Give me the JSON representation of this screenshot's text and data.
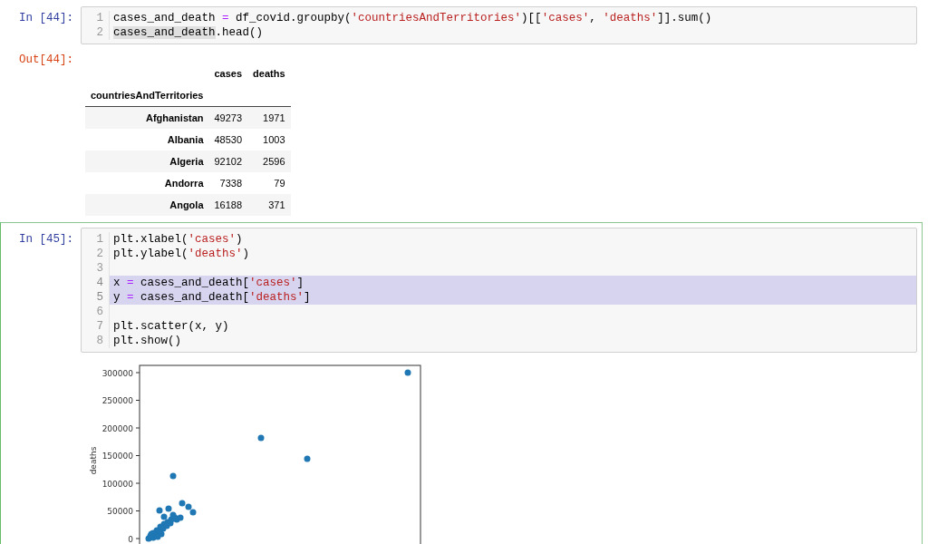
{
  "cells": [
    {
      "prompt": "In [44]:",
      "selected": false,
      "code": [
        {
          "number": "1",
          "highlighted": false,
          "tokens": [
            {
              "text": "cases_and_death ",
              "kind": "plain"
            },
            {
              "text": "=",
              "kind": "operator"
            },
            {
              "text": " df_covid.groupby(",
              "kind": "plain"
            },
            {
              "text": "'countriesAndTerritories'",
              "kind": "string"
            },
            {
              "text": ")[[",
              "kind": "plain"
            },
            {
              "text": "'cases'",
              "kind": "string"
            },
            {
              "text": ", ",
              "kind": "plain"
            },
            {
              "text": "'deaths'",
              "kind": "string"
            },
            {
              "text": "]].sum()",
              "kind": "plain"
            }
          ]
        },
        {
          "number": "2",
          "highlighted": false,
          "tokens": [
            {
              "text": "cases_and_death",
              "kind": "match"
            },
            {
              "text": ".head()",
              "kind": "plain"
            }
          ]
        }
      ],
      "output": {
        "prompt": "Out[44]:",
        "table": {
          "columns": [
            "cases",
            "deaths"
          ],
          "index_name": "countriesAndTerritories",
          "rows": [
            {
              "index": "Afghanistan",
              "values": [
                "49273",
                "1971"
              ]
            },
            {
              "index": "Albania",
              "values": [
                "48530",
                "1003"
              ]
            },
            {
              "index": "Algeria",
              "values": [
                "92102",
                "2596"
              ]
            },
            {
              "index": "Andorra",
              "values": [
                "7338",
                "79"
              ]
            },
            {
              "index": "Angola",
              "values": [
                "16188",
                "371"
              ]
            }
          ]
        }
      }
    },
    {
      "prompt": "In [45]:",
      "selected": true,
      "code": [
        {
          "number": "1",
          "highlighted": false,
          "tokens": [
            {
              "text": "plt.xlabel(",
              "kind": "plain"
            },
            {
              "text": "'cases'",
              "kind": "string"
            },
            {
              "text": ")",
              "kind": "plain"
            }
          ]
        },
        {
          "number": "2",
          "highlighted": false,
          "tokens": [
            {
              "text": "plt.ylabel(",
              "kind": "plain"
            },
            {
              "text": "'deaths'",
              "kind": "string"
            },
            {
              "text": ")",
              "kind": "plain"
            }
          ]
        },
        {
          "number": "3",
          "highlighted": false
        },
        {
          "number": "4",
          "highlighted": true,
          "tokens": [
            {
              "text": "x ",
              "kind": "plain"
            },
            {
              "text": "=",
              "kind": "operator"
            },
            {
              "text": " cases_and_death[",
              "kind": "plain"
            },
            {
              "text": "'cases'",
              "kind": "string"
            },
            {
              "text": "]",
              "kind": "plain"
            }
          ]
        },
        {
          "number": "5",
          "highlighted": true,
          "tokens": [
            {
              "text": "y ",
              "kind": "plain"
            },
            {
              "text": "=",
              "kind": "operator"
            },
            {
              "text": " cases_and_death[",
              "kind": "plain"
            },
            {
              "text": "'deaths'",
              "kind": "string"
            },
            {
              "text": "]",
              "kind": "plain"
            }
          ]
        },
        {
          "number": "6",
          "highlighted": false
        },
        {
          "number": "7",
          "highlighted": false,
          "tokens": [
            {
              "text": "plt.scatter(x, y)",
              "kind": "plain"
            }
          ]
        },
        {
          "number": "8",
          "highlighted": false,
          "tokens": [
            {
              "text": "plt.show()",
              "kind": "plain"
            }
          ]
        }
      ],
      "output": {
        "plot": {
          "ylabel": "deaths",
          "yticks": [
            "300000",
            "250000",
            "200000",
            "150000",
            "100000",
            "50000",
            "0"
          ]
        }
      }
    }
  ]
}
